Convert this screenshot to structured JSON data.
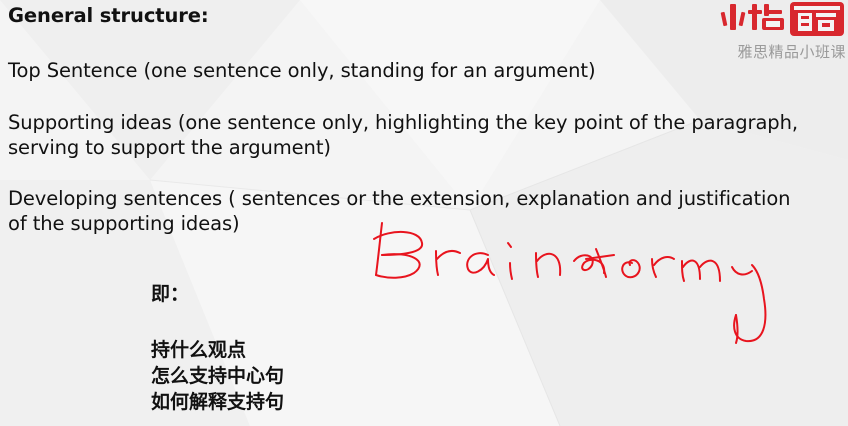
{
  "slide": {
    "heading": "General structure:",
    "paragraphs": {
      "top_sentence": "Top Sentence (one sentence only, standing for an argument)",
      "supporting_line1": "Supporting ideas (one sentence only, highlighting the key point of the paragraph,",
      "supporting_line2": "serving to support the argument)",
      "developing_line1": "Developing sentences ( sentences or the extension, explanation and justification",
      "developing_line2": "of the supporting ideas)"
    },
    "chinese": {
      "label": "即：",
      "line1": "持什么观点",
      "line2": "怎么支持中心句",
      "line3": "如何解释支持句"
    }
  },
  "logo": {
    "tagline": "雅思精品小班课",
    "brand_color": "#d8282e"
  },
  "annotation": {
    "ink_color": "#e8141e",
    "icon": "handwritten-scribble-icon"
  },
  "colors": {
    "background": "#f4f4f4",
    "text": "#111111",
    "logo_gray": "#9a9a9a"
  }
}
